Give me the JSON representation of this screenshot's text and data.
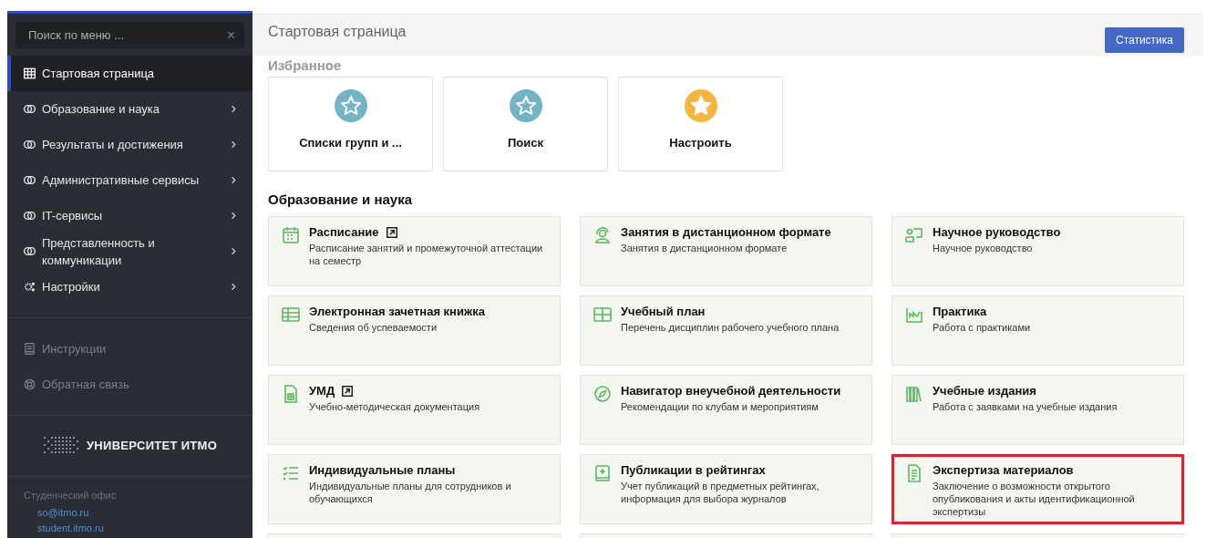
{
  "sidebar": {
    "search": {
      "placeholder": "Поиск по меню ...",
      "clear": "×"
    },
    "items": [
      {
        "label": "Стартовая страница",
        "kind": "grid",
        "selected": true,
        "expandable": false,
        "disabled": false
      },
      {
        "label": "Образование и наука",
        "kind": "toggle",
        "selected": false,
        "expandable": true,
        "disabled": false
      },
      {
        "label": "Результаты и достижения",
        "kind": "toggle",
        "selected": false,
        "expandable": true,
        "disabled": false
      },
      {
        "label": "Административные сервисы",
        "kind": "toggle",
        "selected": false,
        "expandable": true,
        "disabled": false
      },
      {
        "label": "IT-сервисы",
        "kind": "toggle",
        "selected": false,
        "expandable": true,
        "disabled": false
      },
      {
        "label": "Представленность и коммуникации",
        "kind": "toggle",
        "selected": false,
        "expandable": true,
        "disabled": false
      },
      {
        "label": "Настройки",
        "kind": "gears",
        "selected": false,
        "expandable": true,
        "disabled": false
      }
    ],
    "secondary": [
      {
        "label": "Инструкции",
        "kind": "book",
        "selected": false,
        "expandable": false,
        "disabled": true
      },
      {
        "label": "Обратная связь",
        "kind": "lifebuoy",
        "selected": false,
        "expandable": false,
        "disabled": true
      }
    ],
    "logo": "УНИВЕРСИТЕТ ИТМО",
    "office": {
      "label": "Студенческий офис",
      "links": [
        "so@itmo.ru",
        "student.itmo.ru"
      ]
    }
  },
  "header": {
    "title": "Стартовая страница",
    "button": "Статистика"
  },
  "favorites": {
    "heading": "Избранное",
    "items": [
      {
        "label": "Списки групп и ...",
        "filled": false
      },
      {
        "label": "Поиск",
        "filled": false
      },
      {
        "label": "Настроить",
        "filled": true
      }
    ]
  },
  "section": {
    "heading": "Образование и наука",
    "cards": [
      {
        "title": "Расписание",
        "description": "Расписание занятий и промежуточной аттестации на семестр",
        "kind": "calendar",
        "external": true,
        "highlighted": false
      },
      {
        "title": "Занятия в дистанционном формате",
        "description": "Занятия в дистанционном формате",
        "kind": "headset",
        "external": false,
        "highlighted": false
      },
      {
        "title": "Научное руководство",
        "description": "Научное руководство",
        "kind": "board",
        "external": false,
        "highlighted": false
      },
      {
        "title": "Электронная зачетная книжка",
        "description": "Сведения об успеваемости",
        "kind": "table",
        "external": false,
        "highlighted": false
      },
      {
        "title": "Учебный план",
        "description": "Перечень дисциплин рабочего учебного плана",
        "kind": "grid",
        "external": false,
        "highlighted": false
      },
      {
        "title": "Практика",
        "description": "Работа с практиками",
        "kind": "chart",
        "external": false,
        "highlighted": false
      },
      {
        "title": "УМД",
        "description": "Учебно-методическая документация",
        "kind": "sheet",
        "external": true,
        "highlighted": false
      },
      {
        "title": "Навигатор внеучебной деятельности",
        "description": "Рекомендации по клубам и мероприятиям",
        "kind": "compass",
        "external": false,
        "highlighted": false
      },
      {
        "title": "Учебные издания",
        "description": "Работа с заявками на учебные издания",
        "kind": "books",
        "external": false,
        "highlighted": false
      },
      {
        "title": "Индивидуальные планы",
        "description": "Индивидуальные планы для сотрудников и обучающихся",
        "kind": "checklist",
        "external": false,
        "highlighted": false
      },
      {
        "title": "Публикации в рейтингах",
        "description": "Учет публикаций в предметных рейтингах, информация для выбора журналов",
        "kind": "bookstar",
        "external": false,
        "highlighted": false
      },
      {
        "title": "Экспертиза материалов",
        "description": "Заключение о возможности открытого опубликования и акты идентификационной экспертизы",
        "kind": "document",
        "external": false,
        "highlighted": true
      }
    ]
  }
}
